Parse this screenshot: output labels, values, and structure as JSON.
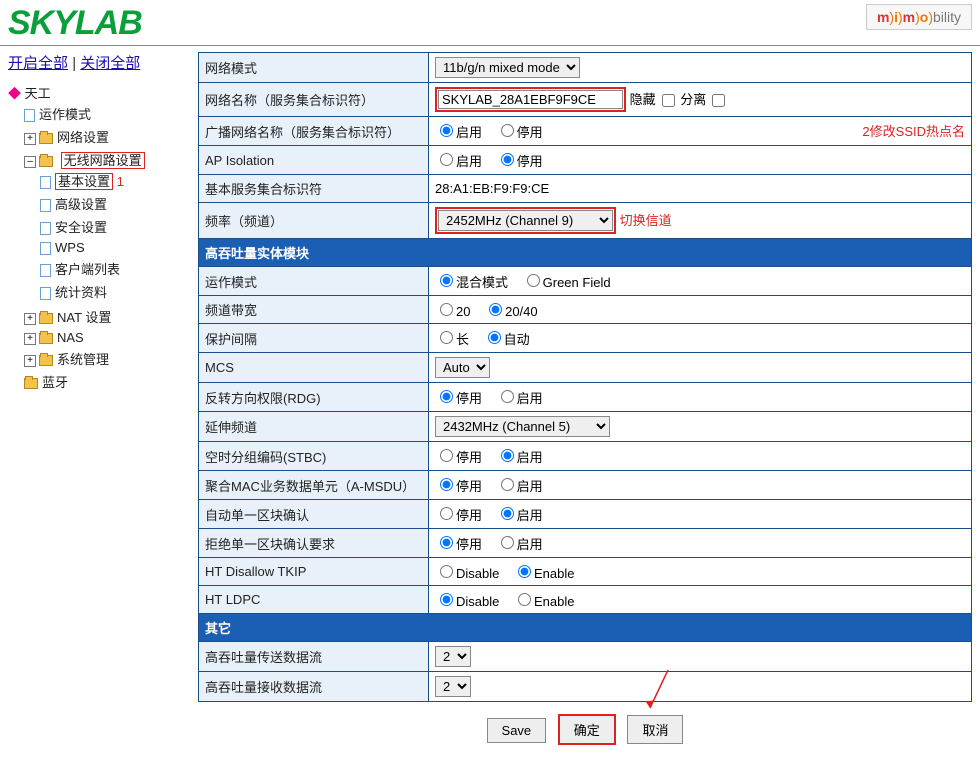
{
  "logo": "SKYLAB",
  "mimo": "m)i)m)o)bility",
  "toplinks": {
    "open_all": "开启全部",
    "close_all": "关闭全部"
  },
  "tree": {
    "root": "天工",
    "m1": "运作模式",
    "m2": "网络设置",
    "m3": "无线网路设置",
    "m3_1": "基本设置",
    "m3_2": "高级设置",
    "m3_3": "安全设置",
    "m3_4": "WPS",
    "m3_5": "客户端列表",
    "m3_6": "统计资料",
    "m4": "NAT 设置",
    "m5": "NAS",
    "m6": "系统管理",
    "m7": "蓝牙",
    "anno1": "1"
  },
  "rows": {
    "r1": {
      "label": "网络模式",
      "value": "11b/g/n mixed mode"
    },
    "r2": {
      "label": "网络名称（服务集合标识符）",
      "value": "SKYLAB_28A1EBF9F9CE",
      "hide": "隐藏",
      "sep": "分离",
      "anno": "2修改SSID热点名"
    },
    "r3": {
      "label": "广播网络名称（服务集合标识符）",
      "opt1": "启用",
      "opt2": "停用"
    },
    "r4": {
      "label": "AP Isolation",
      "opt1": "启用",
      "opt2": "停用"
    },
    "r5": {
      "label": "基本服务集合标识符",
      "value": "28:A1:EB:F9:F9:CE"
    },
    "r6": {
      "label": "频率（频道）",
      "value": "2452MHz (Channel 9)",
      "anno": "切换信道"
    },
    "sec1": "高吞吐量实体模块",
    "r7": {
      "label": "运作模式",
      "opt1": "混合模式",
      "opt2": "Green Field"
    },
    "r8": {
      "label": "频道带宽",
      "opt1": "20",
      "opt2": "20/40"
    },
    "r9": {
      "label": "保护间隔",
      "opt1": "长",
      "opt2": "自动"
    },
    "r10": {
      "label": "MCS",
      "value": "Auto"
    },
    "r11": {
      "label": "反转方向权限(RDG)",
      "opt1": "停用",
      "opt2": "启用"
    },
    "r12": {
      "label": "延伸频道",
      "value": "2432MHz (Channel 5)"
    },
    "r13": {
      "label": "空时分组编码(STBC)",
      "opt1": "停用",
      "opt2": "启用"
    },
    "r14": {
      "label": "聚合MAC业务数据单元（A-MSDU）",
      "opt1": "停用",
      "opt2": "启用"
    },
    "r15": {
      "label": "自动单一区块确认",
      "opt1": "停用",
      "opt2": "启用"
    },
    "r16": {
      "label": "拒绝单一区块确认要求",
      "opt1": "停用",
      "opt2": "启用"
    },
    "r17": {
      "label": "HT Disallow TKIP",
      "opt1": "Disable",
      "opt2": "Enable"
    },
    "r18": {
      "label": "HT LDPC",
      "opt1": "Disable",
      "opt2": "Enable"
    },
    "sec2": "其它",
    "r19": {
      "label": "高吞吐量传送数据流",
      "value": "2"
    },
    "r20": {
      "label": "高吞吐量接收数据流",
      "value": "2"
    }
  },
  "buttons": {
    "save": "Save",
    "ok": "确定",
    "cancel": "取消"
  }
}
